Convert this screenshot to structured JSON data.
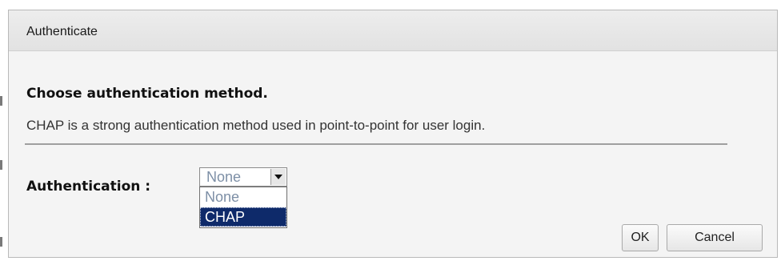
{
  "dialog": {
    "title": "Authenticate",
    "heading": "Choose authentication method.",
    "description": "CHAP is a strong authentication method used in point-to-point for user login.",
    "authentication_label": "Authentication :",
    "select": {
      "selected_value": "None",
      "options": [
        "None",
        "CHAP"
      ],
      "highlighted_option": "CHAP"
    },
    "buttons": {
      "ok_label": "OK",
      "cancel_label": "Cancel"
    },
    "icons": {
      "dropdown_arrow": "chevron-down-icon"
    }
  },
  "colors": {
    "dialog_background": "#f4f4f4",
    "title_bar": "#e6e6e6",
    "select_text": "#7d8fa6",
    "highlight": "#0e2a6a"
  }
}
